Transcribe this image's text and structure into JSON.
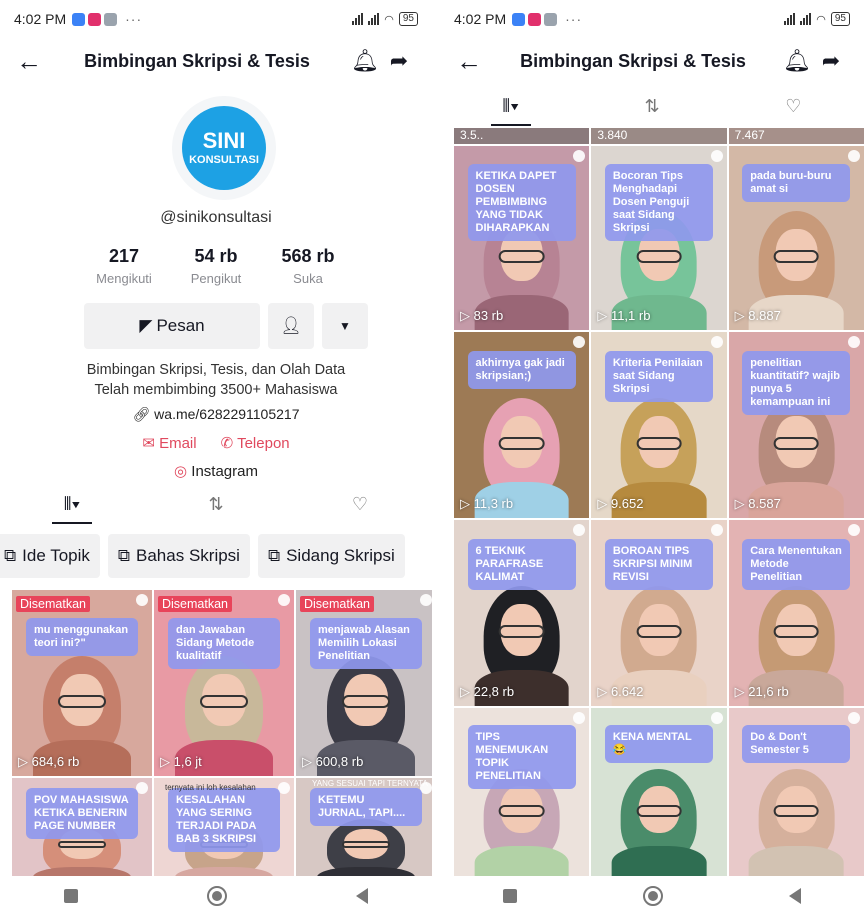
{
  "status": {
    "time": "4:02 PM",
    "dots": "···",
    "battery": "95"
  },
  "header": {
    "title": "Bimbingan Skripsi & Tesis"
  },
  "profile": {
    "logo_line1": "SINI",
    "logo_line2": "KONSULTASI",
    "username": "@sinikonsultasi",
    "stats": [
      {
        "num": "217",
        "label": "Mengikuti"
      },
      {
        "num": "54 rb",
        "label": "Pengikut"
      },
      {
        "num": "568 rb",
        "label": "Suka"
      }
    ],
    "message_label": "Pesan",
    "bio_line1": "Bimbingan Skripsi, Tesis, dan Olah Data",
    "bio_line2": "Telah membimbing 3500+ Mahasiswa",
    "link": "wa.me/6282291105217",
    "email": "Email",
    "phone": "Telepon",
    "instagram": "Instagram"
  },
  "playlists": [
    "Ide Topik",
    "Bahas Skripsi",
    "Sidang Skripsi"
  ],
  "left_videos": [
    {
      "caption": "mu menggunakan teori ini?\"",
      "pinned": "Disematkan",
      "views": "684,6 rb",
      "bg": "#d7a89d",
      "hijab": "#c57f6b",
      "body": "#b56e5a"
    },
    {
      "caption": "dan Jawaban Sidang Metode kualitatif",
      "pinned": "Disematkan",
      "views": "1,6 jt",
      "bg": "#e89aa4",
      "hijab": "#c8b89a",
      "body": "#c94f6a"
    },
    {
      "caption": "menjawab Alasan Memilih Lokasi Penelitian",
      "pinned": "Disematkan",
      "views": "600,8 rb",
      "bg": "#c9c2c4",
      "hijab": "#3b3b46",
      "body": "#5a5a66"
    },
    {
      "caption": "POV MAHASISWA KETIKA BENERIN PAGE NUMBER",
      "pinned": "",
      "views": "",
      "bg": "#e2c4c7",
      "hijab": "#d58f7a",
      "body": "#b7766a"
    },
    {
      "caption": "KESALAHAN YANG SERING TERJADI PADA BAB 3 SKRIPSI",
      "pinned": "",
      "views": "",
      "bg": "#eed6d3",
      "hijab": "#c7a48a",
      "body": "#d6a7a0"
    },
    {
      "caption": "KETEMU JURNAL, TAPI....",
      "pinned": "",
      "views": "",
      "bg": "#d7c8c4",
      "hijab": "#3e3f47",
      "body": "#2f2f36"
    }
  ],
  "left_notes": [
    "ternyata ini loh kesalahan",
    "YANG SESUAI TAPI TERNYATA"
  ],
  "right_top_views": [
    "3.5..",
    "3.840",
    "7.467"
  ],
  "right_videos": [
    {
      "caption": "KETIKA DAPET DOSEN PEMBIMBING YANG TIDAK DIHARAPKAN",
      "views": "83 rb",
      "bg": "#c49aa8",
      "hijab": "#b78394",
      "body": "#9a6676"
    },
    {
      "caption": "Bocoran Tips Menghadapi Dosen Penguji saat Sidang Skripsi",
      "views": "11,1 rb",
      "bg": "#dcd6d0",
      "hijab": "#77c49a",
      "body": "#6fb88e"
    },
    {
      "caption": "pada buru-buru amat si",
      "views": "8.887",
      "bg": "#d3b8a6",
      "hijab": "#c89a7a",
      "body": "#e7d7c8"
    },
    {
      "caption": "akhirnya gak jadi skripsian;)",
      "views": "11,3 rb",
      "bg": "#9d7a55",
      "hijab": "#e6a1b3",
      "body": "#9fd0e6"
    },
    {
      "caption": "Kriteria Penilaian saat Sidang Skripsi",
      "views": "9.652",
      "bg": "#e5d8c8",
      "hijab": "#c6a15a",
      "body": "#b68a3e"
    },
    {
      "caption": "penelitian kuantitatif? wajib punya 5 kemampuan ini",
      "views": "8.587",
      "bg": "#d9a7a8",
      "hijab": "#b78b7d",
      "body": "#d9a49a"
    },
    {
      "caption": "6 TEKNIK PARAFRASE KALIMAT",
      "views": "22,8 rb",
      "bg": "#e2d4cc",
      "hijab": "#1f2024",
      "body": "#3d2f2c"
    },
    {
      "caption": "BOROAN TIPS SKRIPSI MINIM REVISI",
      "views": "6.642",
      "bg": "#e9d3c8",
      "hijab": "#d1aa8f",
      "body": "#e9d0bf"
    },
    {
      "caption": "Cara Menentukan Metode Penelitian",
      "views": "21,6 rb",
      "bg": "#e3b3b3",
      "hijab": "#c59a74",
      "body": "#c9a89a"
    },
    {
      "caption": "TIPS MENEMUKAN TOPIK PENELITIAN",
      "views": "",
      "bg": "#ece2dc",
      "hijab": "#c7a7b6",
      "body": "#b2d2a6"
    },
    {
      "caption": "KENA MENTAL😂",
      "views": "",
      "bg": "#d7e2d4",
      "hijab": "#4a8c6a",
      "body": "#2f6e52"
    },
    {
      "caption": "Do & Don't Semester 5",
      "views": "",
      "bg": "#e8c9c9",
      "hijab": "#d5b09c",
      "body": "#d2c2b2"
    }
  ]
}
